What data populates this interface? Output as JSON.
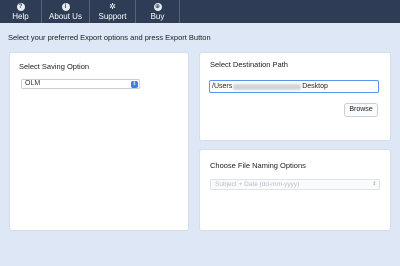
{
  "toolbar": {
    "items": [
      {
        "label": "Help",
        "icon": "help-icon",
        "glyph": "?"
      },
      {
        "label": "About Us",
        "icon": "info-icon",
        "glyph": "i"
      },
      {
        "label": "Support",
        "icon": "gear-icon",
        "glyph": "✲"
      },
      {
        "label": "Buy",
        "icon": "cart-icon",
        "glyph": "⊕"
      }
    ]
  },
  "instruction": "Select your preferred Export options and press Export Button",
  "saving": {
    "title": "Select Saving Option",
    "selected": "OLM",
    "arrow": "⇕"
  },
  "destination": {
    "title": "Select Destination Path",
    "path_prefix": "/Users",
    "path_suffix": "Desktop",
    "browse_label": "Browse"
  },
  "naming": {
    "title": "Choose File Naming Options",
    "selected": "Subject + Date (dd-mm-yyyy)",
    "arrow": "⇕"
  },
  "colors": {
    "toolbar_bg": "#2e3d55",
    "page_bg": "#dde7f6",
    "accent": "#3b7ef0"
  }
}
